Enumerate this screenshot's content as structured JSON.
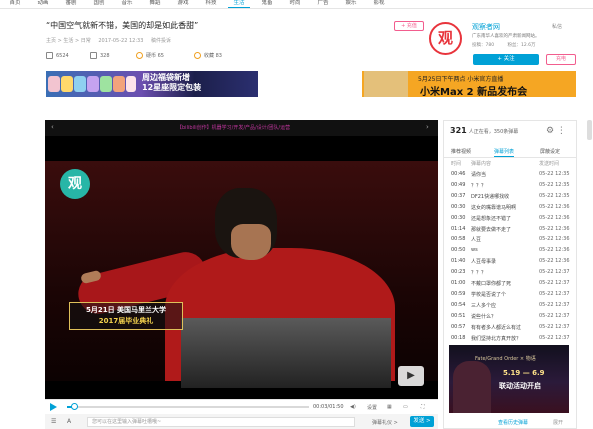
{
  "nav": [
    "首页",
    "动画",
    "番剧",
    "国创",
    "音乐",
    "舞蹈",
    "游戏",
    "科技",
    "生活",
    "鬼畜",
    "时尚",
    "广告",
    "娱乐",
    "影视"
  ],
  "nav_active": "生活",
  "video": {
    "title": "“中国空气就新不错，美国的却是如此香甜”",
    "breadcrumb": "主页 > 生活 > 日常",
    "date": "2017-05-22 12:33",
    "report": "稿件投诉",
    "views": "6524",
    "danmaku_count": "328",
    "coins_label": "硬币",
    "coins": "65",
    "favorites_label": "收藏",
    "favorites": "83",
    "player_title": "【bilibili创作】机器学习/开发/产品/设计/团队/运营",
    "caption_line1": "5月21日 美国马里兰大学",
    "caption_line2": "2017届毕业典礼",
    "logo_char": "观",
    "time": "00:03/01:50",
    "progress_pct": 3
  },
  "controls": {
    "settings": "设置",
    "more1": "▦",
    "more2": "⛶"
  },
  "danmaku_bar": {
    "placeholder": "您可以在这里输入弹幕吐槽哦~",
    "etiquette": "弹幕礼仪 >",
    "send": "发送 >"
  },
  "uploader": {
    "follow_tag": "+ 充值",
    "avatar_char": "观",
    "name": "观察者网",
    "message": "私信",
    "desc": "广东南华人喜欢的严肃新闻网站。",
    "posts": "投稿：780",
    "fans": "粉丝：12.6万",
    "follow": "+ 关注",
    "charge": "充电"
  },
  "banners": {
    "left_text_1": "周边福袋新增",
    "left_text_2": "12星座限定包装",
    "right_text_1": "5月25日下午两点  小米官方直播",
    "right_text_2": "小米Max 2 新品发布会"
  },
  "panel": {
    "viewers": "321",
    "viewers_suffix": "人正在看，350条弹幕",
    "tabs": [
      "推荐视频",
      "弹幕列表",
      "屏蔽设定"
    ],
    "active_tab": "弹幕列表",
    "cols": [
      "时间",
      "弹幕内容",
      "发送时间"
    ],
    "rows": [
      {
        "t": "00:46",
        "c": "请你当",
        "d": "05-22 12:35"
      },
      {
        "t": "00:49",
        "c": "？？？",
        "d": "05-22 12:35"
      },
      {
        "t": "00:37",
        "c": "DF21快递哪找收",
        "d": "05-22 12:35"
      },
      {
        "t": "00:30",
        "c": "这女的嘴靠谱马明啊",
        "d": "05-22 12:36"
      },
      {
        "t": "00:30",
        "c": "还是想象还不错了",
        "d": "05-22 12:36"
      },
      {
        "t": "01:14",
        "c": "那就要去做不走了",
        "d": "05-22 12:36"
      },
      {
        "t": "00:58",
        "c": "人豆",
        "d": "05-22 12:36"
      },
      {
        "t": "00:50",
        "c": "ws",
        "d": "05-22 12:36"
      },
      {
        "t": "01:40",
        "c": "人豆母事录",
        "d": "05-22 12:36"
      },
      {
        "t": "00:23",
        "c": "？？？",
        "d": "05-22 12:37"
      },
      {
        "t": "01:00",
        "c": "不戴口罩你都了死",
        "d": "05-22 12:37"
      },
      {
        "t": "00:59",
        "c": "学校是否说了个",
        "d": "05-22 12:37"
      },
      {
        "t": "00:54",
        "c": "三人多个应",
        "d": "05-22 12:37"
      },
      {
        "t": "00:51",
        "c": "说些什么？",
        "d": "05-22 12:37"
      },
      {
        "t": "00:57",
        "c": "有有者多人都近么有过",
        "d": "05-22 12:37"
      },
      {
        "t": "00:18",
        "c": "我们坚持北方真开放？",
        "d": "05-22 12:37"
      }
    ],
    "ad_line1": "Fate/Grand Order × 物语",
    "ad_line2": "5.19 — 6.9",
    "ad_line3": "联动活动开启",
    "history": "查看历史弹幕",
    "expand": "展开"
  }
}
